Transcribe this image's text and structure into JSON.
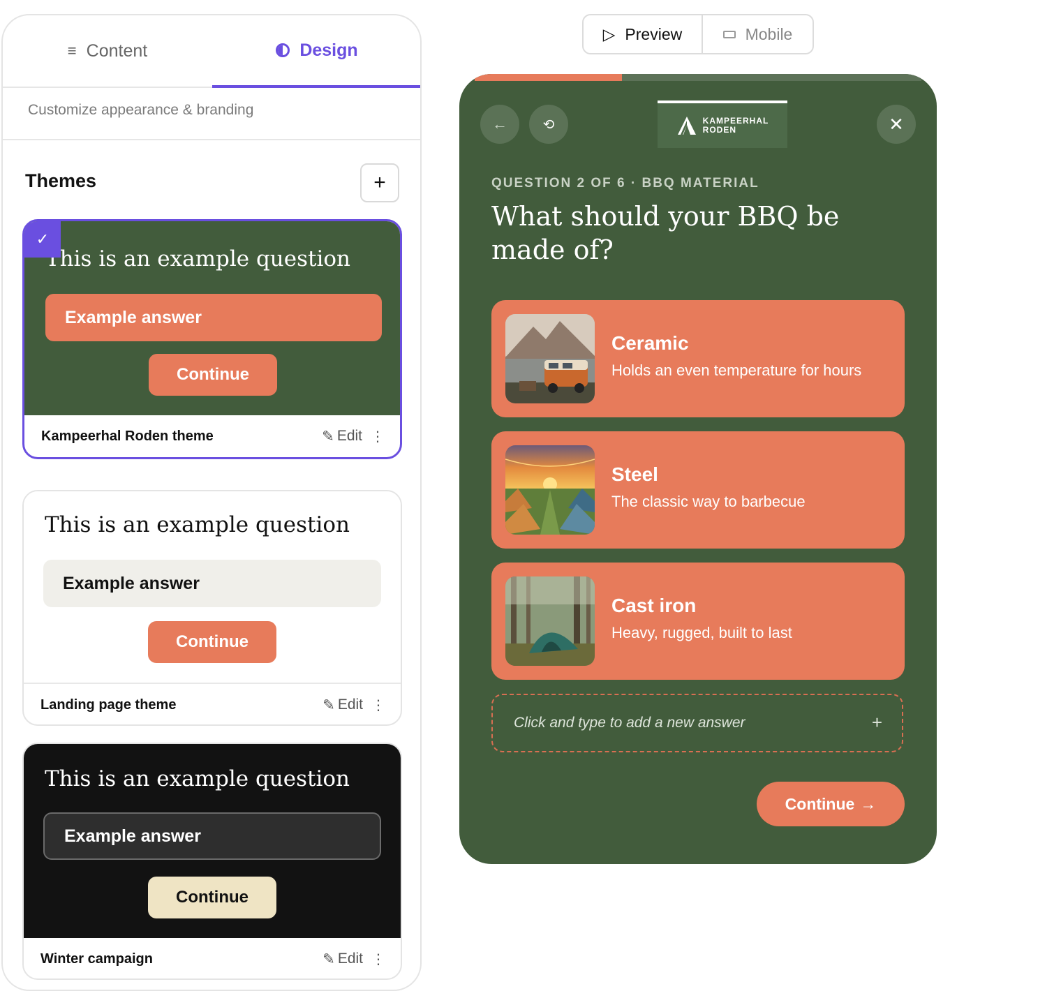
{
  "tabs": {
    "content_label": "Content",
    "design_label": "Design"
  },
  "panel": {
    "subtitle": "Customize appearance & branding",
    "themes_title": "Themes",
    "add_theme": "+"
  },
  "themes": [
    {
      "name": "Kampeerhal Roden theme",
      "question": "This is an example question",
      "answer": "Example answer",
      "continue": "Continue",
      "edit": "Edit",
      "selected": true,
      "colors": {
        "bg": "#425c3c",
        "answer": "#e77b5b",
        "button": "#e77b5b"
      }
    },
    {
      "name": "Landing page theme",
      "question": "This is an example question",
      "answer": "Example answer",
      "continue": "Continue",
      "edit": "Edit",
      "selected": false,
      "colors": {
        "bg": "#ffffff",
        "answer": "#f0efea",
        "button": "#e77b5b"
      }
    },
    {
      "name": "Winter campaign",
      "question": "This is an example question",
      "answer": "Example answer",
      "continue": "Continue",
      "edit": "Edit",
      "selected": false,
      "colors": {
        "bg": "#121212",
        "answer": "#2e2e2e",
        "button": "#efe4c4"
      }
    }
  ],
  "view_toggle": {
    "preview_label": "Preview",
    "mobile_label": "Mobile",
    "active": "preview"
  },
  "quiz": {
    "progress": 0.33,
    "brand_line1": "KAMPEERHAL",
    "brand_line2": "RODEN",
    "kicker": "QUESTION 2 OF 6 · BBQ MATERIAL",
    "question": "What should your BBQ be made of?",
    "answers": [
      {
        "title": "Ceramic",
        "description": "Holds an even temperature for hours",
        "image": "van-by-lake-photo"
      },
      {
        "title": "Steel",
        "description": "The classic way to barbecue",
        "image": "festival-tents-photo"
      },
      {
        "title": "Cast iron",
        "description": "Heavy, rugged, built to last",
        "image": "tent-in-forest-photo"
      }
    ],
    "add_answer_placeholder": "Click and type to add a new answer",
    "continue_label": "Continue",
    "colors": {
      "bg": "#425c3c",
      "accent": "#e77b5b"
    }
  },
  "accent_color": "#6a4fe0"
}
